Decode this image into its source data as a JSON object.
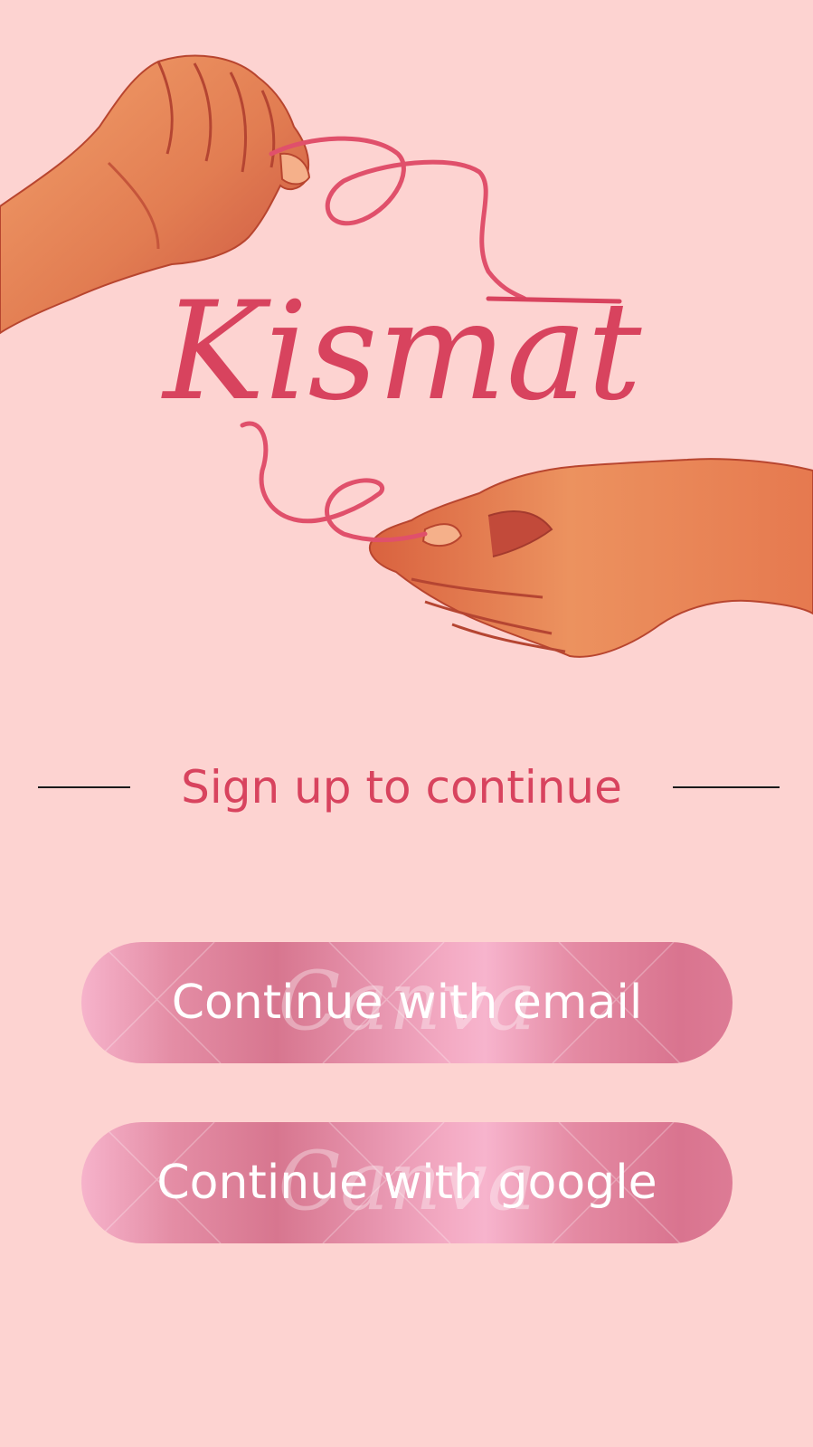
{
  "app": {
    "brand_name": "Kismat"
  },
  "signup": {
    "heading": "Sign up to continue"
  },
  "auth_buttons": {
    "email_label": "Continue with email",
    "google_label": "Continue with google"
  },
  "watermark": {
    "text": "Canva"
  },
  "colors": {
    "background": "#fdd3d1",
    "accent": "#d8435e",
    "thread": "#e0506b",
    "button_gradient": [
      "#f6b3cb",
      "#d7768f",
      "#f7b4cd",
      "#d9748f"
    ],
    "skin": "#e98a5c"
  },
  "hero": {
    "illustration": "two-hands-holding-red-thread"
  }
}
